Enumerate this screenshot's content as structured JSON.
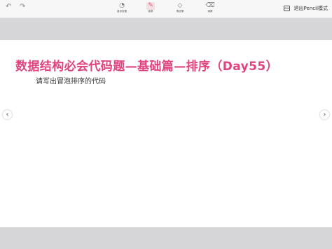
{
  "toolbar": {
    "undo_icon": "undo-icon",
    "redo_icon": "redo-icon",
    "tools": [
      {
        "label": "重设设置",
        "icon": "laser-pointer-icon"
      },
      {
        "label": "画笔",
        "icon": "pen-icon"
      },
      {
        "label": "橡皮擦",
        "icon": "eraser-icon"
      },
      {
        "label": "清屏",
        "icon": "clear-icon"
      }
    ],
    "exit_label": "退出Pencil模式",
    "exit_icon": "calendar-icon"
  },
  "slide": {
    "title": "数据结构必会代码题—基础篇—排序（Day55）",
    "subtitle": "请写出冒泡排序的代码"
  },
  "nav": {
    "prev_icon": "chevron-left-icon",
    "next_icon": "chevron-right-icon"
  },
  "colors": {
    "title": "#e2437f",
    "active_tool": "#e05a7a",
    "background": "#d6d6d8"
  }
}
